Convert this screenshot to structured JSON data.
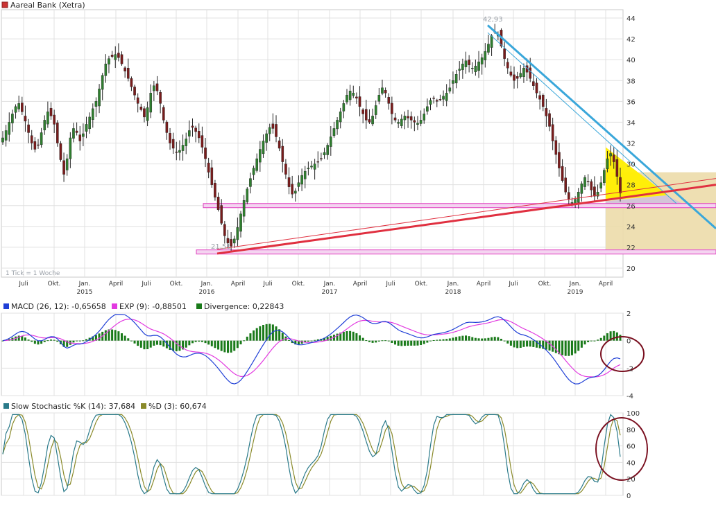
{
  "title": "Aareal Bank (Xetra)",
  "colors": {
    "title_box": "#cc3333",
    "candle_up": "#2f7f2f",
    "candle_down": "#7a1c1c",
    "downtrend": "#3aa7da",
    "uptrend": "#e03040",
    "support": "#e040c0",
    "triangle": "#ffee00",
    "projection": "#ecdcaa",
    "macd": "#1f3fd6",
    "signal": "#e23ae0",
    "divergence": "#1a7a1a",
    "stoch_k": "#2a7a8a",
    "stoch_d": "#8a8a2a",
    "circle": "#7a1020",
    "grid": "#e0e0e0"
  },
  "chart_data": [
    {
      "type": "candlestick",
      "title": "Aareal Bank (Xetra)",
      "note": "1 Tick = 1 Woche",
      "x_ticks": [
        "Juli",
        "Okt.",
        "Jan.",
        "April",
        "Juli",
        "Okt.",
        "Jan.",
        "April",
        "Juli",
        "Okt.",
        "Jan.",
        "April",
        "Juli",
        "Okt.",
        "Jan.",
        "April",
        "Juli",
        "Okt.",
        "Jan.",
        "April"
      ],
      "year_labels": [
        "2015",
        "2016",
        "2017",
        "2018",
        "2019"
      ],
      "y_ticks": [
        20,
        22,
        24,
        26,
        28,
        30,
        32,
        34,
        36,
        38,
        40,
        42,
        44
      ],
      "ylim": [
        19,
        45
      ],
      "annotations": [
        {
          "label": "42,93",
          "value": 42.93
        },
        {
          "label": "21,51",
          "value": 21.51
        }
      ],
      "close_series": [
        32.5,
        33.2,
        34,
        34.8,
        35.5,
        35.8,
        35,
        34.1,
        33,
        32,
        31.4,
        31.8,
        33,
        34.2,
        35,
        34.6,
        33.8,
        32,
        30.4,
        29,
        30.5,
        32.5,
        33.4,
        33,
        32.2,
        32.9,
        33.8,
        34.5,
        35.3,
        36,
        37.2,
        38.5,
        39.6,
        40.1,
        40.3,
        40.5,
        40.2,
        39.6,
        38.9,
        38.2,
        37.4,
        36.6,
        35.8,
        35.2,
        34.5,
        35.4,
        36.8,
        37.5,
        37,
        35.8,
        34.2,
        33,
        32,
        31.5,
        31.1,
        31.3,
        31.8,
        32.4,
        33.2,
        33.5,
        33.1,
        32.5,
        31.6,
        30.5,
        29.2,
        28,
        26.8,
        25.6,
        24.3,
        23.1,
        22.4,
        22.1,
        22.8,
        23.9,
        25.2,
        26.5,
        27.6,
        28.6,
        29.6,
        30.5,
        31.4,
        32.2,
        32.9,
        33.5,
        33.4,
        32.6,
        31.5,
        30.2,
        29,
        27.8,
        27.1,
        27.4,
        28.2,
        28.9,
        29.3,
        29.6,
        29.8,
        30,
        30.2,
        30.5,
        31.1,
        31.8,
        32.6,
        33.4,
        34.2,
        35,
        35.8,
        36.6,
        37,
        36.8,
        36.3,
        35.5,
        34.8,
        34.2,
        34,
        34.6,
        35.6,
        36.6,
        37.3,
        36.8,
        35.8,
        34.8,
        34.2,
        34,
        34.3,
        34.6,
        34.4,
        34.2,
        34,
        33.9,
        34.2,
        34.8,
        35.5,
        36.1,
        36.3,
        36,
        36.2,
        36.5,
        36.8,
        37.3,
        38,
        38.6,
        39.1,
        39.6,
        39.9,
        39.5,
        39.2,
        39.4,
        39.8,
        40.2,
        40.8,
        41.5,
        42.3,
        42.7,
        42.4,
        41.3,
        40.1,
        39.2,
        38.5,
        38,
        38.2,
        38.7,
        39.2,
        38.8,
        38.2,
        37.5,
        36.8,
        36.2,
        35.5,
        34.6,
        33.6,
        32.2,
        30.9,
        29.6,
        28.4,
        27.3,
        26.6,
        26.3,
        26.6,
        27.3,
        28.1,
        28.7,
        28.3,
        27.5,
        26.9,
        27.3,
        28.2,
        29.4,
        30.5,
        31,
        30.2,
        28.8,
        27.2
      ]
    },
    {
      "type": "line",
      "title": "MACD",
      "legend": [
        "MACD (26, 12): -0,65658",
        "EXP (9): -0,88501",
        "Divergence: 0,22843"
      ],
      "y_ticks": [
        "2",
        "0",
        "-2",
        "-4"
      ],
      "ylim": [
        -4,
        2
      ]
    },
    {
      "type": "line",
      "title": "Slow Stochastic",
      "legend": [
        "Slow Stochastic %K (14): 37,684",
        "%D (3): 60,674"
      ],
      "y_ticks": [
        "100",
        "80",
        "60",
        "40",
        "20",
        "0"
      ],
      "ylim": [
        0,
        100
      ]
    }
  ]
}
